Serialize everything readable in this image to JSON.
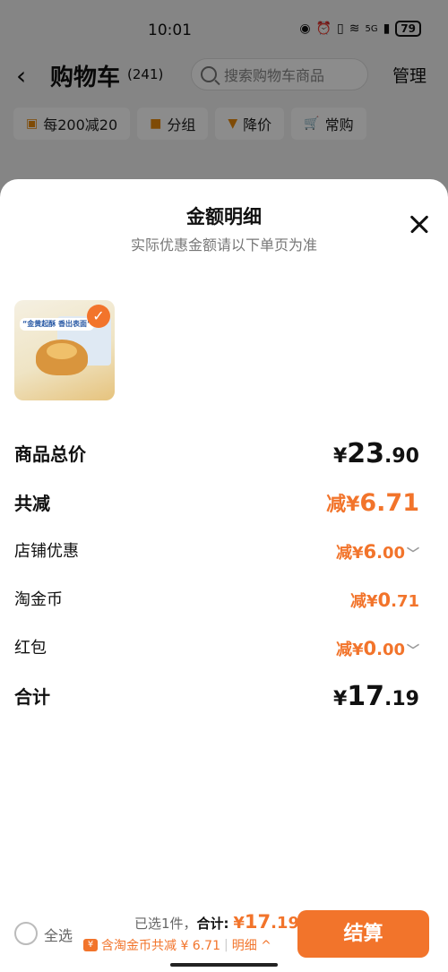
{
  "status": {
    "time": "10:01",
    "network": "5G",
    "battery": "79"
  },
  "nav": {
    "back": "‹",
    "title": "购物车",
    "count": "(241)",
    "search_placeholder": "搜索购物车商品",
    "manage": "管理"
  },
  "chips": [
    {
      "icon": "gift-icon",
      "label": "每200减20"
    },
    {
      "icon": "folder-icon",
      "label": "分组"
    },
    {
      "icon": "down-arrow-icon",
      "label": "降价"
    },
    {
      "icon": "cart-icon",
      "label": "常购"
    }
  ],
  "sheet": {
    "title": "金额明细",
    "subtitle": "实际优惠金额请以下单页为准",
    "product_image_text": "“金黄起酥 香出表面”"
  },
  "rows": {
    "total_price": {
      "label": "商品总价",
      "currency": "¥",
      "int": "23",
      "dec": ".90"
    },
    "total_discount": {
      "label": "共减",
      "prefix": "减¥",
      "amount": "6.71"
    },
    "shop_discount": {
      "label": "店铺优惠",
      "prefix": "减¥",
      "int": "6",
      "dec": ".00"
    },
    "taojinbi": {
      "label": "淘金币",
      "prefix": "减¥",
      "int": "0",
      "dec": ".71"
    },
    "red_packet": {
      "label": "红包",
      "prefix": "减¥",
      "int": "0",
      "dec": ".00"
    },
    "grand_total": {
      "label": "合计",
      "currency": "¥",
      "int": "17",
      "dec": ".19"
    }
  },
  "bottom": {
    "select_all": "全选",
    "selected": "已选1件，",
    "total_label": "合计:",
    "total_currency": "¥",
    "total_int": "17",
    "total_dec": ".19",
    "coin_text": "含淘金币共减 ¥ 6.71",
    "detail_link": "明细 ^",
    "checkout": "结算"
  },
  "colors": {
    "accent": "#f2742b"
  }
}
